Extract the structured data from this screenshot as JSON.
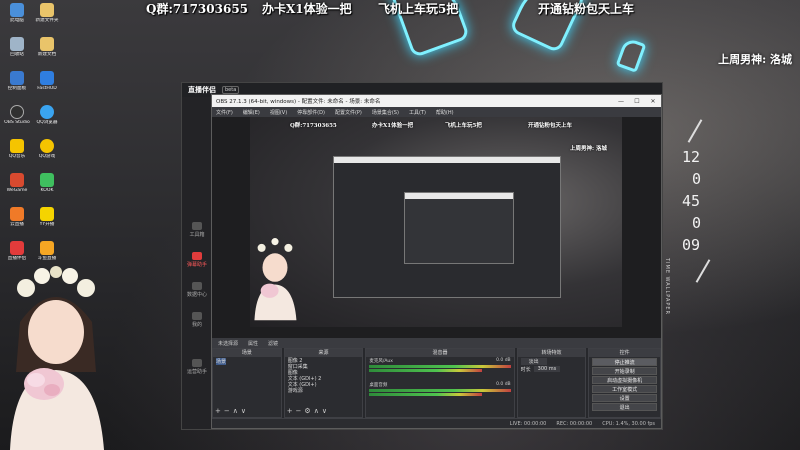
{
  "overlay": {
    "qq": "Q群:717303655",
    "card": "办卡X1体验一把",
    "plane": "飞机上车玩5把",
    "fan": "开通钻粉包天上车",
    "rank": "上周男神: 洛城"
  },
  "desktop_icons": [
    {
      "label": "此电脑",
      "color": "#4a8fd9"
    },
    {
      "label": "回收站",
      "color": "#9fb4c8"
    },
    {
      "label": "控制面板",
      "color": "#3a7ad0"
    },
    {
      "label": "OBS Studio",
      "color": "#303030"
    },
    {
      "label": "QQ音乐",
      "color": "#f5c400"
    },
    {
      "label": "WeGame",
      "color": "#d84a2f"
    },
    {
      "label": "云直播",
      "color": "#f07a28"
    },
    {
      "label": "直播伴侣",
      "color": "#e23b3b"
    },
    {
      "label": "新建文件夹",
      "color": "#e9c46a"
    },
    {
      "label": "新建文档",
      "color": "#e9c46a"
    },
    {
      "label": "FastHUD",
      "color": "#2f7ee0"
    },
    {
      "label": "QQ浏览器",
      "color": "#3aa4f0"
    },
    {
      "label": "QQ游戏",
      "color": "#f5c400"
    },
    {
      "label": "KOOK",
      "color": "#3fbf5f"
    },
    {
      "label": "YY开播",
      "color": "#f5d400"
    },
    {
      "label": "斗鱼直播",
      "color": "#f5a623"
    }
  ],
  "clock": {
    "hour": "12",
    "min_a": "0",
    "minute": "45",
    "min_b": "0",
    "second": "09"
  },
  "vertical_text": "TIME WALLPAPER",
  "app": {
    "logo": "直播伴侣",
    "badge": "beta",
    "sidebar": [
      {
        "label": "工具箱"
      },
      {
        "label": "弹幕助手"
      },
      {
        "label": "数据中心"
      },
      {
        "label": "我的"
      },
      {
        "label": "运营助手"
      }
    ]
  },
  "obs": {
    "title": "OBS 27.1.3 (64-bit, windows) - 配置文件: 未命名 - 场景: 未命名",
    "menu": [
      "文件(F)",
      "编辑(E)",
      "视图(V)",
      "停靠部件(D)",
      "配置文件(P)",
      "场景集合(S)",
      "工具(T)",
      "帮助(H)"
    ],
    "preview_text": {
      "qq": "Q群:717303655",
      "card": "办卡X1体验一把",
      "plane": "飞机上车玩5把",
      "fan": "开通钻粉包天上车",
      "rank": "上周男神: 洛城"
    },
    "dock_bar": [
      "未选择源",
      "属性",
      "滤镜"
    ],
    "docks": {
      "scenes": {
        "title": "场景",
        "items": [
          "场景"
        ]
      },
      "sources": {
        "title": "来源",
        "items": [
          "图像 2",
          "窗口采集",
          "图像",
          "文本 (GDI+) 2",
          "文本 (GDI+)",
          "游戏源"
        ]
      },
      "mixer": {
        "title": "混音器",
        "tracks": [
          {
            "name": "麦克风/Aux",
            "db": "0.0 dB"
          },
          {
            "name": "桌面音频",
            "db": "0.0 dB"
          }
        ]
      },
      "transitions": {
        "title": "转场特效",
        "mode": "淡出",
        "duration_label": "时长",
        "duration": "300 ms"
      },
      "controls": {
        "title": "控件",
        "buttons": [
          "停止推流",
          "开始录制",
          "启动虚拟摄像机",
          "工作室模式",
          "设置",
          "退出"
        ]
      }
    },
    "status": [
      "LIVE: 00:00:00",
      "REC: 00:00:00",
      "CPU: 1.4%, 30.00 fps"
    ]
  }
}
